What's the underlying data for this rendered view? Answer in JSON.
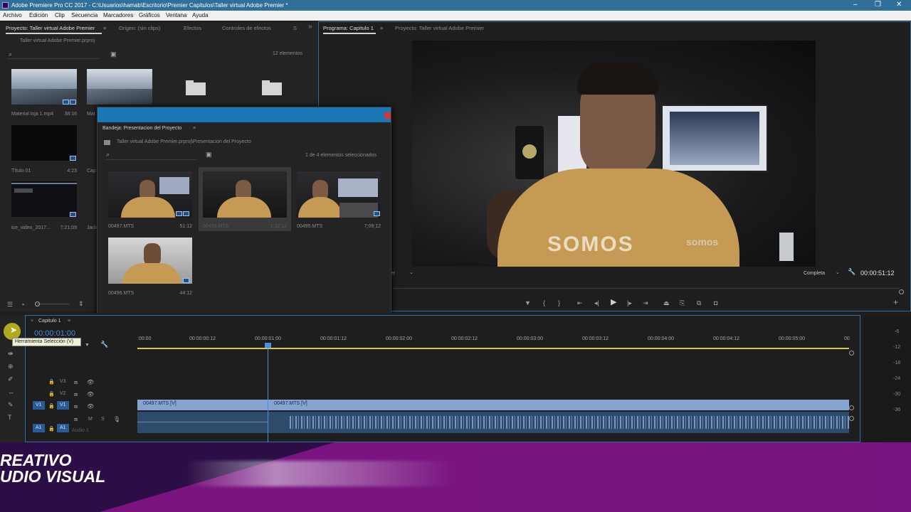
{
  "titlebar": {
    "title": "Adobe Premiere Pro CC 2017 - C:\\Usuarios\\hamab\\Escritorio\\Premier Capitulos\\Taller virtual Adobe Premier *",
    "min": "–",
    "restore": "❐",
    "close": "✕"
  },
  "menu": [
    "Archivo",
    "Edición",
    "Clip",
    "Secuencia",
    "Marcadores",
    "Gráficos",
    "Ventana",
    "Ayuda"
  ],
  "project_panel": {
    "tabs": [
      "Proyecto: Taller virtual Adobe Premier",
      "Origen: (sin clips)",
      "Efectos",
      "Controles de efectos",
      "S"
    ],
    "menu_icon": "≡",
    "overflow_icon": "»",
    "file": "Taller virtual Adobe Premier.prproj",
    "count": "12 elementos",
    "items": [
      {
        "name": "Material loja 1.mp4",
        "duration": "38:16"
      },
      {
        "name": "Mat",
        "duration": ""
      },
      {
        "name": "Título 01",
        "duration": "4:23"
      },
      {
        "name": "Cap",
        "duration": ""
      },
      {
        "name": "ice_video_2017...",
        "duration": "7;21;09"
      },
      {
        "name": "Jack",
        "duration": ""
      }
    ]
  },
  "bin": {
    "title": "Bandeja: Presentacion del Proyecto",
    "path": "Taller virtual Adobe Premier.prproj\\Presentacion del Proyecto",
    "selection": "1 de 4 elementos seleccionados",
    "clips": [
      {
        "name": "00497.MTS",
        "duration": "51:12"
      },
      {
        "name": "00498.MTS",
        "duration": "1;32;12"
      },
      {
        "name": "00495.MTS",
        "duration": "7;09;12"
      },
      {
        "name": "00496.MTS",
        "duration": "44:12"
      }
    ]
  },
  "program_panel": {
    "tabs": [
      "Programa: Capitulo 1",
      "Proyecto: Taller virtual Adobe Premier"
    ],
    "menu_icon": "≡",
    "fit": "er",
    "quality": "Completa",
    "timecode": "00:00:51:12",
    "video_text": {
      "shirt": "SOMOS",
      "shirt_small": "somos"
    }
  },
  "timeline": {
    "tab": "Capitulo 1",
    "close_icon": "×",
    "menu_icon": "≡",
    "timecode": "00:00:01:00",
    "tooltip": "Herramienta Selección (V)",
    "ruler": [
      ":00:00",
      "00:00:00:12",
      "00:00:01:00",
      "00:00:01:12",
      "00:00:02:00",
      "00:00:02:12",
      "00:00:03:00",
      "00:00:03:12",
      "00:00:04:00",
      "00:00:04:12",
      "00:00:05:00",
      "00"
    ],
    "tracks": {
      "v3": "V3",
      "v2": "V2",
      "v1": "V1",
      "a1": "A1",
      "audio1": "Audio 1",
      "m": "M",
      "s": "S"
    },
    "clips": [
      {
        "name": "00497.MTS [V]"
      },
      {
        "name": "00497.MTS [V]"
      }
    ],
    "meter_ticks": [
      "-6",
      "-12",
      "-18",
      "-24",
      "-30",
      "-36"
    ]
  },
  "banner": {
    "line1": "REATIVO",
    "line2": "UDIO VISUAL"
  }
}
